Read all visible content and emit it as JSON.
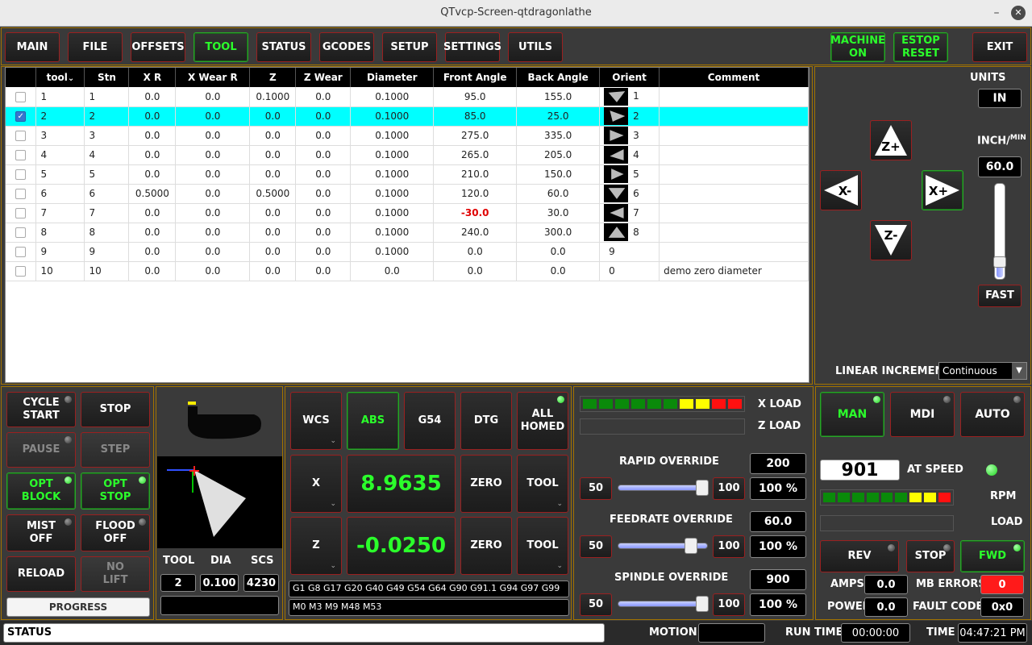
{
  "window": {
    "title": "QTvcp-Screen-qtdragonlathe"
  },
  "tabs": [
    {
      "label": "MAIN"
    },
    {
      "label": "FILE"
    },
    {
      "label": "OFFSETS"
    },
    {
      "label": "TOOL"
    },
    {
      "label": "STATUS"
    },
    {
      "label": "GCODES"
    },
    {
      "label": "SETUP"
    },
    {
      "label": "SETTINGS"
    },
    {
      "label": "UTILS"
    }
  ],
  "machine_on": "MACHINE\nON",
  "estop": "ESTOP\nRESET",
  "exit": "EXIT",
  "tool_table": {
    "headers": [
      "",
      "tool",
      "Stn",
      "X R",
      "X Wear R",
      "Z",
      "Z Wear",
      "Diameter",
      "Front Angle",
      "Back Angle",
      "Orient",
      "Comment"
    ],
    "rows": [
      {
        "checked": false,
        "tool": "1",
        "stn": "1",
        "xr": "0.0",
        "xwear": "0.0",
        "z": "0.1000",
        "zwear": "0.0",
        "dia": "0.1000",
        "front": "95.0",
        "back": "155.0",
        "orient": "1",
        "comment": ""
      },
      {
        "checked": true,
        "tool": "2",
        "stn": "2",
        "xr": "0.0",
        "xwear": "0.0",
        "z": "0.0",
        "zwear": "0.0",
        "dia": "0.1000",
        "front": "85.0",
        "back": "25.0",
        "orient": "2",
        "comment": ""
      },
      {
        "checked": false,
        "tool": "3",
        "stn": "3",
        "xr": "0.0",
        "xwear": "0.0",
        "z": "0.0",
        "zwear": "0.0",
        "dia": "0.1000",
        "front": "275.0",
        "back": "335.0",
        "orient": "3",
        "comment": ""
      },
      {
        "checked": false,
        "tool": "4",
        "stn": "4",
        "xr": "0.0",
        "xwear": "0.0",
        "z": "0.0",
        "zwear": "0.0",
        "dia": "0.1000",
        "front": "265.0",
        "back": "205.0",
        "orient": "4",
        "comment": ""
      },
      {
        "checked": false,
        "tool": "5",
        "stn": "5",
        "xr": "0.0",
        "xwear": "0.0",
        "z": "0.0",
        "zwear": "0.0",
        "dia": "0.1000",
        "front": "210.0",
        "back": "150.0",
        "orient": "5",
        "comment": ""
      },
      {
        "checked": false,
        "tool": "6",
        "stn": "6",
        "xr": "0.5000",
        "xwear": "0.0",
        "z": "0.5000",
        "zwear": "0.0",
        "dia": "0.1000",
        "front": "120.0",
        "back": "60.0",
        "orient": "6",
        "comment": ""
      },
      {
        "checked": false,
        "tool": "7",
        "stn": "7",
        "xr": "0.0",
        "xwear": "0.0",
        "z": "0.0",
        "zwear": "0.0",
        "dia": "0.1000",
        "front": "-30.0",
        "back": "30.0",
        "orient": "7",
        "comment": ""
      },
      {
        "checked": false,
        "tool": "8",
        "stn": "8",
        "xr": "0.0",
        "xwear": "0.0",
        "z": "0.0",
        "zwear": "0.0",
        "dia": "0.1000",
        "front": "240.0",
        "back": "300.0",
        "orient": "8",
        "comment": ""
      },
      {
        "checked": false,
        "tool": "9",
        "stn": "9",
        "xr": "0.0",
        "xwear": "0.0",
        "z": "0.0",
        "zwear": "0.0",
        "dia": "0.1000",
        "front": "0.0",
        "back": "0.0",
        "orient": "9",
        "comment": ""
      },
      {
        "checked": false,
        "tool": "10",
        "stn": "10",
        "xr": "0.0",
        "xwear": "0.0",
        "z": "0.0",
        "zwear": "0.0",
        "dia": "0.0",
        "front": "0.0",
        "back": "0.0",
        "orient": "0",
        "comment": "demo zero diameter"
      }
    ]
  },
  "jog": {
    "units_label": "UNITS",
    "units_value": "IN",
    "rate_label": "INCH/MIN",
    "rate_value": "60.0",
    "fast": "FAST",
    "increment_label": "LINEAR INCREMENT",
    "increment_value": "Continuous",
    "zplus": "Z+",
    "zminus": "Z-",
    "xplus": "X+",
    "xminus": "X-",
    "rate_fraction": 0.15
  },
  "controls": {
    "cycle_start": "CYCLE\nSTART",
    "stop": "STOP",
    "pause": "PAUSE",
    "step": "STEP",
    "opt_block": "OPT\nBLOCK",
    "opt_stop": "OPT\nSTOP",
    "mist": "MIST\nOFF",
    "flood": "FLOOD\nOFF",
    "reload": "RELOAD",
    "no_lift": "NO\nLIFT",
    "progress": "PROGRESS"
  },
  "toolinfo": {
    "tool_label": "TOOL",
    "dia_label": "DIA",
    "scs_label": "SCS",
    "tool": "2",
    "dia": "0.100",
    "scs": "4230"
  },
  "dro": {
    "wcs": "WCS",
    "abs": "ABS",
    "g54": "G54",
    "dtg": "DTG",
    "all_homed": "ALL\nHOMED",
    "x_label": "X",
    "x_value": "8.9635",
    "z_label": "Z",
    "z_value": "-0.0250",
    "zero": "ZERO",
    "tool": "TOOL",
    "gcodes": "G1 G8 G17 G20 G40 G49 G54 G64 G90 G91.1 G94 G97 G99",
    "mcodes": "M0 M3 M9 M48 M53"
  },
  "overrides": {
    "x_load": "X LOAD",
    "z_load": "Z LOAD",
    "rapid_label": "RAPID OVERRIDE",
    "rapid_value": "200",
    "rapid_pct": "100 %",
    "feed_label": "FEEDRATE OVERRIDE",
    "feed_value": "60.0",
    "feed_pct": "100 %",
    "spindle_label": "SPINDLE OVERRIDE",
    "spindle_value": "900",
    "spindle_pct": "100 %",
    "min": "50",
    "max": "100",
    "rapid_level": 1.0,
    "feed_level": 0.85,
    "spindle_level": 1.0
  },
  "spindle": {
    "man": "MAN",
    "mdi": "MDI",
    "auto": "AUTO",
    "rpm": "901",
    "at_speed": "AT SPEED",
    "rpm_label": "RPM",
    "load_label": "LOAD",
    "rev": "REV",
    "stop": "STOP",
    "fwd": "FWD",
    "amps_label": "AMPS",
    "amps": "0.0",
    "mb_errors_label": "MB ERRORS",
    "mb_errors": "0",
    "power_label": "POWER",
    "power": "0.0",
    "fault_label": "FAULT CODE",
    "fault": "0x0"
  },
  "statusbar": {
    "status": "STATUS",
    "motion": "MOTION",
    "run_time_label": "RUN TIME",
    "run_time": "00:00:00",
    "time_label": "TIME",
    "time": "04:47:21 PM"
  },
  "colors": {
    "accent_green": "#2bff2b",
    "border_red": "#9a2020",
    "panel_border": "#a27300",
    "selection": "#00ffff"
  }
}
